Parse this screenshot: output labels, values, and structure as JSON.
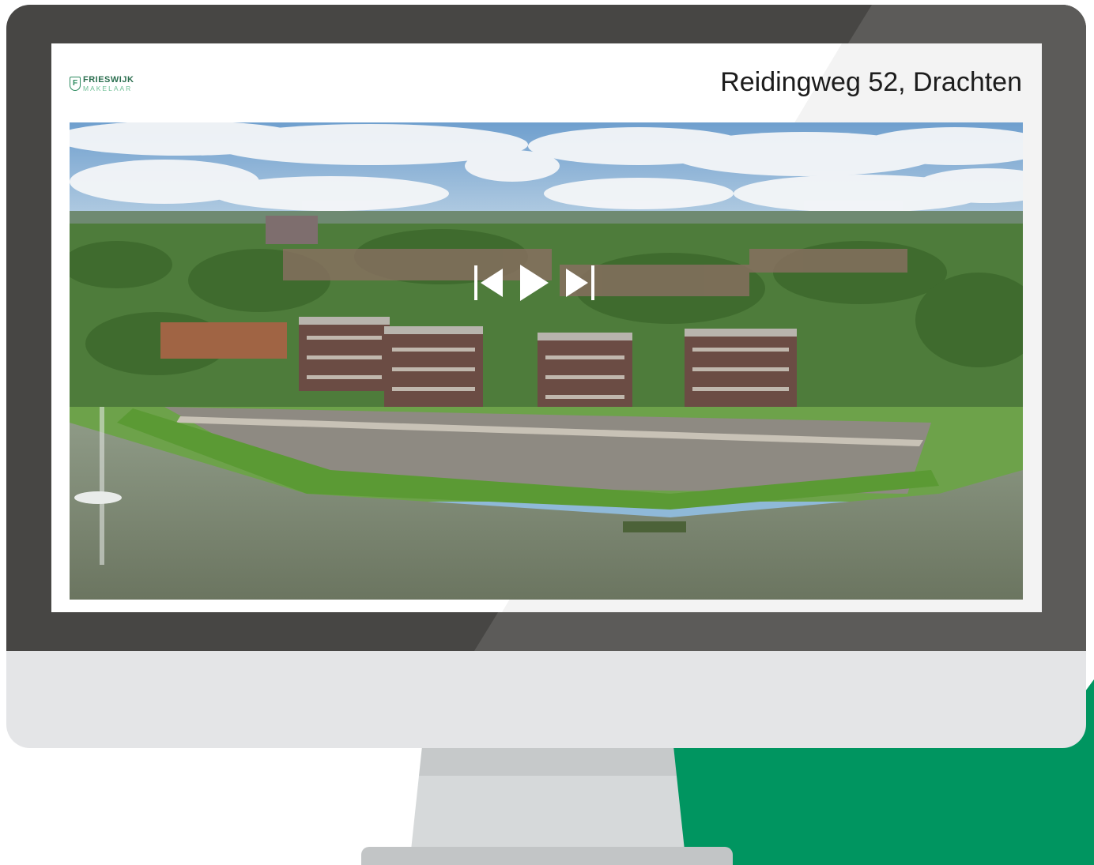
{
  "logo": {
    "name": "FRIESWIJK",
    "sub": "MAKELAAR",
    "mark": "F"
  },
  "listing": {
    "address": "Reidingweg 52, Drachten"
  },
  "photo": {
    "icon": "aerial-photo-image"
  },
  "controls": {
    "previous_icon": "skip-back-icon",
    "play_icon": "play-icon",
    "next_icon": "skip-forward-icon"
  },
  "colors": {
    "bezel": "#474644",
    "frame": "#e4e5e7",
    "accent_green": "#009560",
    "logo_green": "#2b8a5e"
  }
}
